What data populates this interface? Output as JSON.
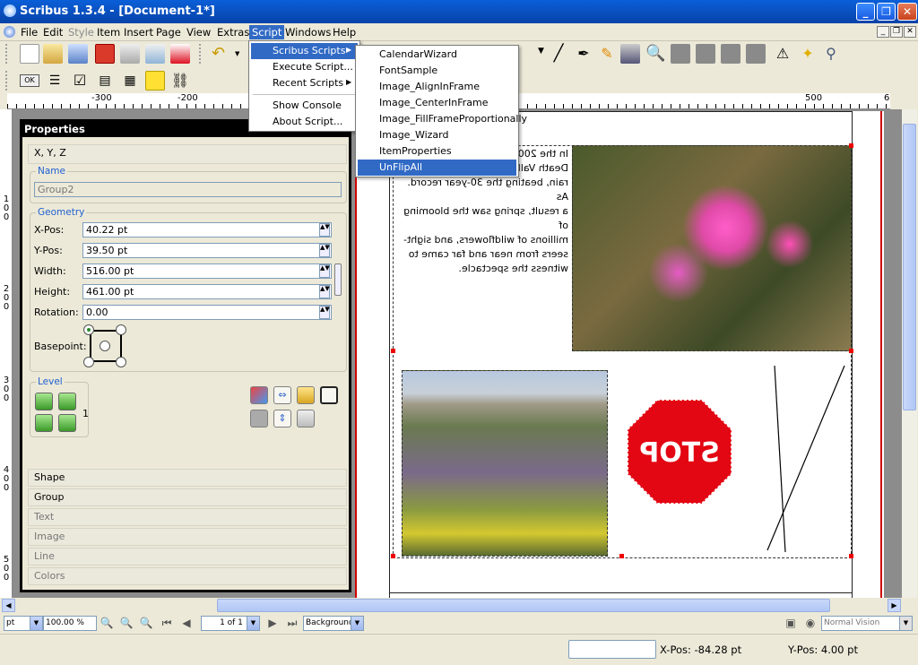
{
  "window": {
    "title": "Scribus 1.3.4 - [Document-1*]"
  },
  "menubar": {
    "items": [
      "File",
      "Edit",
      "Style",
      "Item",
      "Insert",
      "Page",
      "View",
      "Extras",
      "Script",
      "Windows",
      "Help"
    ]
  },
  "script_menu": {
    "items": [
      {
        "label": "Scribus Scripts",
        "submenu": true
      },
      {
        "label": "Execute Script..."
      },
      {
        "label": "Recent Scripts",
        "submenu": true
      },
      {
        "label": "Show Console"
      },
      {
        "label": "About Script..."
      }
    ]
  },
  "scribus_scripts_submenu": {
    "items": [
      "CalendarWizard",
      "FontSample",
      "Image_AlignInFrame",
      "Image_CenterInFrame",
      "Image_FillFrameProportionally",
      "Image_Wizard",
      "ItemProperties",
      "UnFlipAll"
    ]
  },
  "ruler": {
    "h_labels": [
      "-300",
      "-200",
      "500",
      "6"
    ],
    "v_labels": [
      "1\n0\n0",
      "2\n0\n0",
      "3\n0\n0",
      "4\n0\n0",
      "5\n0\n0"
    ]
  },
  "properties": {
    "title": "Properties",
    "section_xyz": "X, Y, Z",
    "name_label": "Name",
    "name_value": "Group2",
    "geometry_label": "Geometry",
    "xpos_label": "X-Pos:",
    "xpos": "40.22 pt",
    "ypos_label": "Y-Pos:",
    "ypos": "39.50 pt",
    "width_label": "Width:",
    "width": "516.00 pt",
    "height_label": "Height:",
    "height": "461.00 pt",
    "rotation_label": "Rotation:",
    "rotation": "0.00",
    "basepoint_label": "Basepoint:",
    "level_label": "Level",
    "level_value": "1",
    "tabs": [
      "Shape",
      "Group",
      "Text",
      "Image",
      "Line",
      "Colors"
    ]
  },
  "document": {
    "mirrored_text_lines": [
      "In the 200",
      "Death Vall",
      "rain, beating the 30-year record. As",
      "a result, spring saw the blooming of",
      "millions of wildflowers, and sight-",
      "seers from near and far came to",
      "witness the spectacle."
    ],
    "stop_text": "STOP"
  },
  "navbar": {
    "unit": "pt",
    "zoom": "100.00 %",
    "page": "1 of 1",
    "layer": "Background",
    "vision": "Normal Vision"
  },
  "status": {
    "xpos": "X-Pos: -84.28 pt",
    "ypos": "Y-Pos: 4.00 pt"
  },
  "colors": {
    "title": "#0842a8",
    "highlight": "#316ac5",
    "stop": "#e30613",
    "page_margin": "#d00000"
  }
}
